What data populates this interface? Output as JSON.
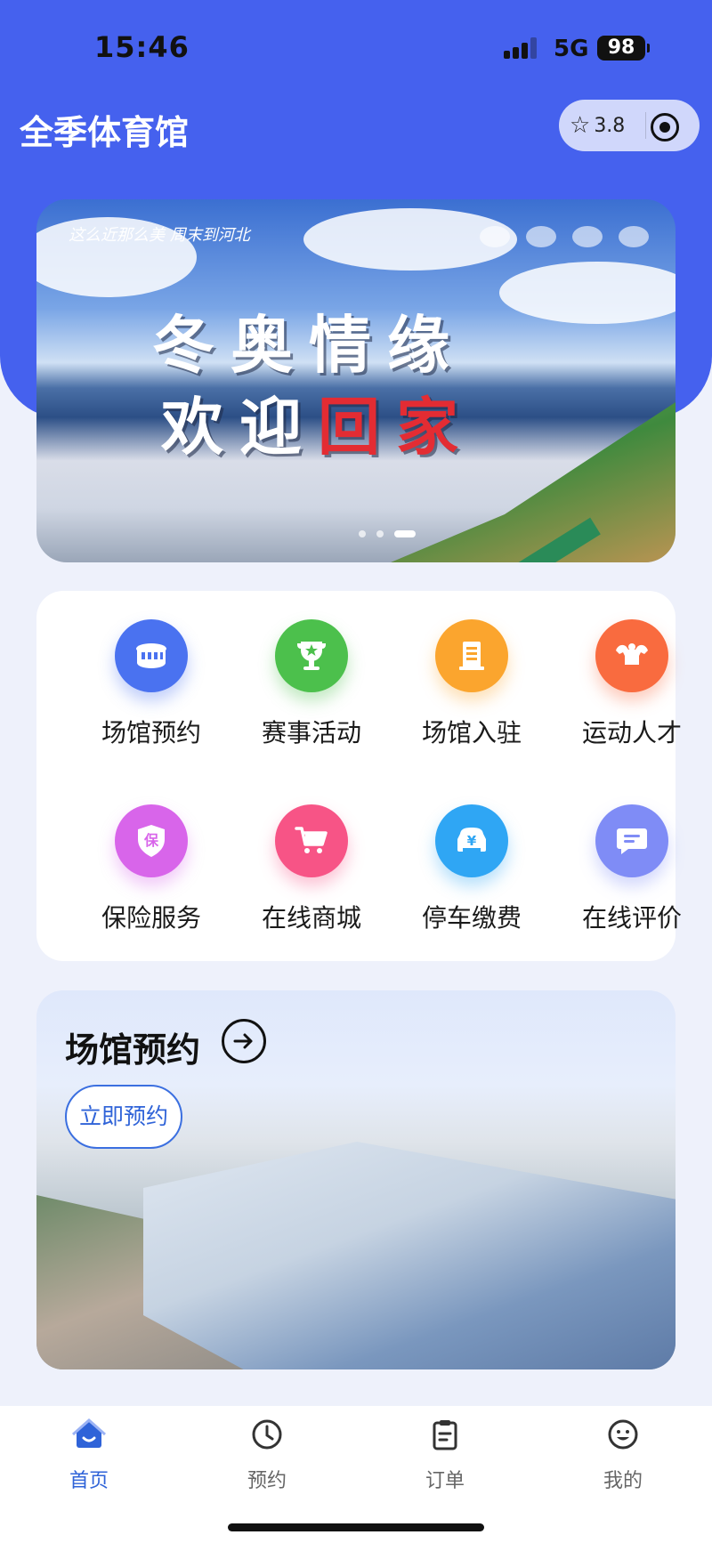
{
  "status_bar": {
    "time": "15:46",
    "network": "5G",
    "battery": "98"
  },
  "header": {
    "title": "全季体育馆",
    "rating": "3.8"
  },
  "banner": {
    "line1": "冬奥情缘",
    "line2_white": "欢迎",
    "line2_red": "回家",
    "logo_text": "这么近那么美 周末到河北",
    "slides_count": 3,
    "active_slide": 3
  },
  "services": [
    {
      "label": "场馆预约",
      "icon": "stadium-icon",
      "color": "#4a72f0"
    },
    {
      "label": "赛事活动",
      "icon": "trophy-icon",
      "color": "#4cc04c"
    },
    {
      "label": "场馆入驻",
      "icon": "building-icon",
      "color": "#fba52e"
    },
    {
      "label": "运动人才",
      "icon": "muscle-icon",
      "color": "#f96b3f"
    },
    {
      "label": "保险服务",
      "icon": "insurance-shield-icon",
      "color": "#d865ea"
    },
    {
      "label": "在线商城",
      "icon": "shopping-cart-icon",
      "color": "#f75486"
    },
    {
      "label": "停车缴费",
      "icon": "parking-car-icon",
      "color": "#2fa6f4"
    },
    {
      "label": "在线评价",
      "icon": "chat-comment-icon",
      "color": "#7f8cf6"
    }
  ],
  "booking_card": {
    "title": "场馆预约",
    "button": "立即预约"
  },
  "tabs": [
    {
      "label": "首页",
      "icon": "home-icon",
      "active": true
    },
    {
      "label": "预约",
      "icon": "clock-icon",
      "active": false
    },
    {
      "label": "订单",
      "icon": "order-clipboard-icon",
      "active": false
    },
    {
      "label": "我的",
      "icon": "smile-profile-icon",
      "active": false
    }
  ],
  "colors": {
    "primary": "#4561ee",
    "accent_blue": "#2f63d8",
    "background": "#eef1fb"
  }
}
